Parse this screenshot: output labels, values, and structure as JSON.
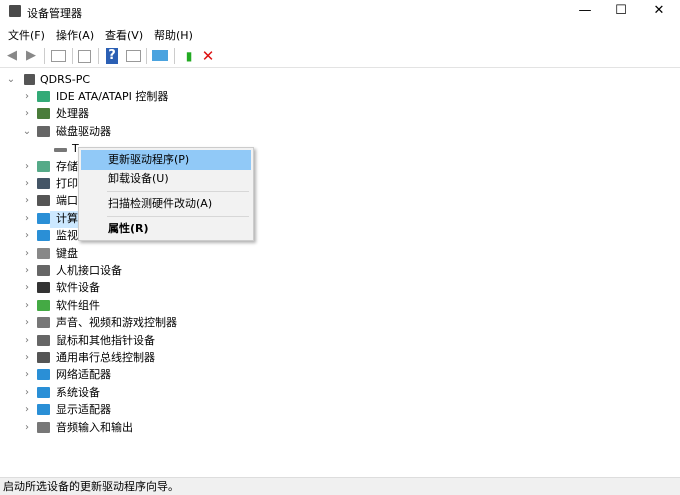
{
  "window": {
    "title": "设备管理器",
    "minimize": "—",
    "maximize": "☐",
    "close": "✕"
  },
  "menu": [
    "文件(F)",
    "操作(A)",
    "查看(V)",
    "帮助(H)"
  ],
  "toolbar": [
    "back-icon",
    "forward-icon",
    "show-hide-console-tree-icon",
    "properties-icon",
    "help-icon",
    "action-pane-icon",
    "scan-hardware-icon",
    "update-driver-icon",
    "uninstall-icon"
  ],
  "tree": {
    "root": "QDRS-PC",
    "items": [
      {
        "label": "IDE ATA/ATAPI 控制器",
        "expanded": false
      },
      {
        "label": "处理器",
        "expanded": false
      },
      {
        "label": "磁盘驱动器",
        "expanded": true
      },
      {
        "label": "T",
        "child": true
      },
      {
        "label": "存储",
        "expanded": false
      },
      {
        "label": "打印",
        "expanded": false
      },
      {
        "label": "端口",
        "expanded": false
      },
      {
        "label": "计算",
        "expanded": false
      },
      {
        "label": "监视",
        "expanded": false
      },
      {
        "label": "键盘",
        "expanded": false
      },
      {
        "label": "人机接口设备",
        "expanded": false
      },
      {
        "label": "软件设备",
        "expanded": false
      },
      {
        "label": "软件组件",
        "expanded": false
      },
      {
        "label": "声音、视频和游戏控制器",
        "expanded": false
      },
      {
        "label": "鼠标和其他指针设备",
        "expanded": false
      },
      {
        "label": "通用串行总线控制器",
        "expanded": false
      },
      {
        "label": "网络适配器",
        "expanded": false
      },
      {
        "label": "系统设备",
        "expanded": false
      },
      {
        "label": "显示适配器",
        "expanded": false
      },
      {
        "label": "音频输入和输出",
        "expanded": false
      }
    ]
  },
  "context_menu": [
    "更新驱动程序(P)",
    "卸载设备(U)",
    "扫描检测硬件改动(A)",
    "属性(R)"
  ],
  "status": "启动所选设备的更新驱动程序向导。",
  "colors": {
    "highlight": "#91c9f7",
    "uninstall": "#d11",
    "monitor": "#2a8fd6"
  }
}
